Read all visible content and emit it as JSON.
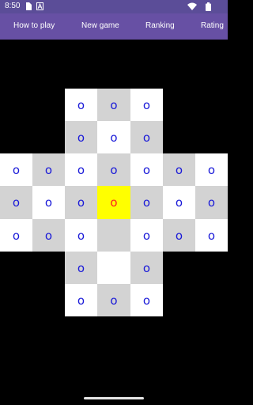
{
  "status_bar": {
    "time": "8:50",
    "icons": [
      "sim-card-icon",
      "text-a-icon",
      "wifi-icon",
      "battery-icon"
    ]
  },
  "menu": {
    "items": [
      {
        "label": "How to play"
      },
      {
        "label": "New game"
      },
      {
        "label": "Ranking"
      },
      {
        "label": "Rating"
      }
    ]
  },
  "board": {
    "piece_symbol": "o",
    "rows": [
      [
        "",
        "",
        "o",
        "o",
        "o",
        "",
        ""
      ],
      [
        "",
        "",
        "o",
        "o",
        "o",
        "",
        ""
      ],
      [
        "o",
        "o",
        "o",
        "o",
        "o",
        "o",
        "o"
      ],
      [
        "o",
        "o",
        "o",
        "o",
        "o",
        "o",
        "o"
      ],
      [
        "o",
        "o",
        "o",
        "",
        "o",
        "o",
        "o"
      ],
      [
        "",
        "",
        "o",
        "",
        "o",
        "",
        ""
      ],
      [
        "",
        "",
        "o",
        "o",
        "o",
        "",
        ""
      ]
    ],
    "selected_cell": {
      "row": 3,
      "col": 3
    },
    "colors": {
      "light": "#ffffff",
      "dark": "#d3d3d3",
      "selected": "#ffff00",
      "piece": "#1a1ad8",
      "selected_piece": "#ff2020",
      "background": "#000000",
      "app_bar": "#6750a4"
    }
  }
}
